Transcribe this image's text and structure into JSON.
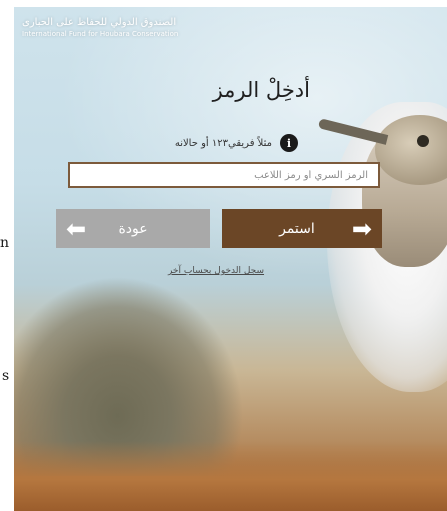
{
  "side_letters": {
    "left_1": "n",
    "left_2": "s"
  },
  "organization": {
    "name_ar": "الصندوق الدولي للحفاظ على الحبارى",
    "name_en": "International Fund for Houbara Conservation"
  },
  "login": {
    "title": "أدخِلْ الرمز",
    "hint": "مثلاً فريقي١٢٣ أو حالانه",
    "info_icon_glyph": "i",
    "code_placeholder": "الرمز السري أو رمز اللاعب",
    "code_value": ""
  },
  "buttons": {
    "back_label": "عودة",
    "back_arrow": "⬅",
    "next_label": "استمر",
    "next_arrow": "➡"
  },
  "register_link": "سجل الدخول بحساب آخر",
  "colors": {
    "next_button": "#6b4626",
    "back_button": "#a9a9a9",
    "input_border": "#7c5a3b"
  }
}
